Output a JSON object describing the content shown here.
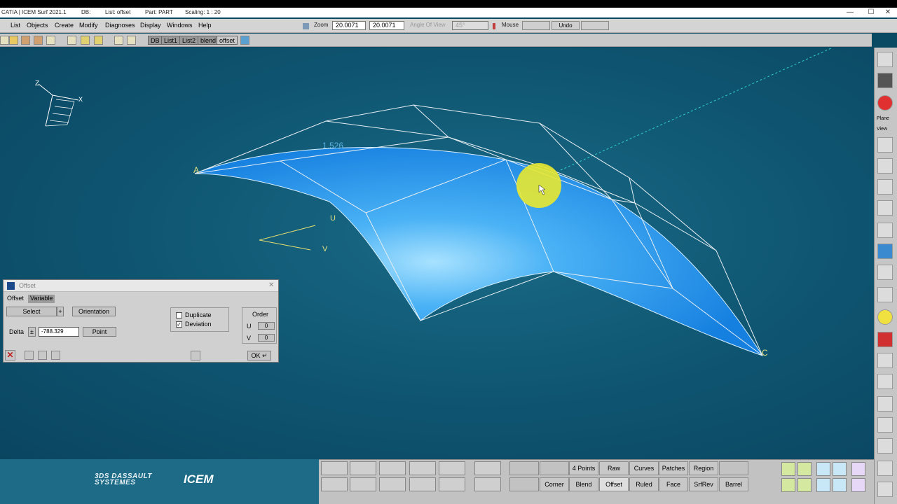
{
  "titlebar": {
    "app": "CATIA | ICEM Surf 2021.1",
    "db": "DB:",
    "list": "List: offset",
    "part": "Part: PART",
    "scaling": "Scaling: 1 : 20",
    "minimize": "—",
    "maximize": "☐",
    "close": "✕"
  },
  "menu": {
    "items": [
      "List",
      "Objects",
      "Create",
      "Modify",
      "Diagnoses",
      "Display",
      "Windows",
      "Help"
    ],
    "zoom_label": "Zoom",
    "zoom_value_1": "20.0071",
    "zoom_value_2": "20.0071",
    "angle_label": "Angle Of View",
    "angle_value": "45°",
    "mouse_label": "Mouse",
    "undo_label": "Undo"
  },
  "toolbar2": {
    "tabs": [
      "DB",
      "List1",
      "List2",
      "blend",
      "offset"
    ]
  },
  "viewport": {
    "axis_z": "Z",
    "axis_x": "X",
    "label_a": "A",
    "label_c": "C",
    "label_u": "U",
    "label_v": "V",
    "measurement": "1.526"
  },
  "right_toolbar": {
    "plane_label": "Plane",
    "view_label": "View"
  },
  "logos": {
    "dassault_line1": "3DS DASSAULT",
    "dassault_line2": "SYSTEMES",
    "icem": "ICEM"
  },
  "commands": {
    "row1": [
      "4 Points",
      "Raw",
      "Curves",
      "Patches",
      "Region"
    ],
    "row2": [
      "Corner",
      "Blend",
      "Offset",
      "Ruled",
      "Face",
      "SrfRev",
      "Barrel"
    ]
  },
  "dialog": {
    "title": "Offset",
    "tab_offset": "Offset",
    "tab_variable": "Variable",
    "select_label": "Select",
    "plus_label": "+",
    "orientation_label": "Orientation",
    "delta_label": "Delta",
    "pm_label": "±",
    "delta_value": "-788.329",
    "point_label": "Point",
    "duplicate_label": "Duplicate",
    "duplicate_checked": false,
    "deviation_label": "Deviation",
    "deviation_checked": true,
    "deviation_mark": "✓",
    "order_label": "Order",
    "u_label": "U",
    "u_value": "0",
    "v_label": "V",
    "v_value": "0",
    "ok_label": "OK ↵",
    "close_mark": "✕"
  },
  "colors": {
    "surface": "#1e90ee",
    "background": "#0f5672",
    "highlight": "#e8e830",
    "wire": "#ffffff"
  }
}
